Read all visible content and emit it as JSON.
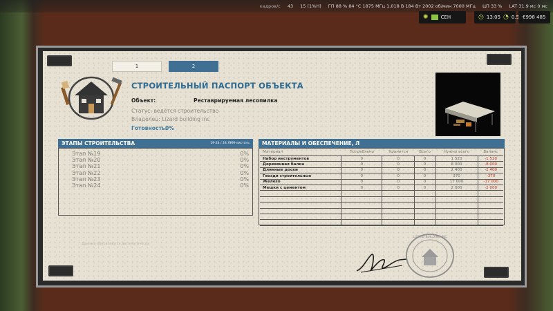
{
  "hud": {
    "fps_label": "кадров/с",
    "fps_value": "43",
    "frame_time": "15 (1%Н)",
    "gpu": "ГП 88 % 84 °C 1875 МГц 1,018 В 184 Вт 2002 об/мин 7000 МГц",
    "cpu": "ЦП 33 %",
    "lat": "LAT 31.9 мс 0 мс",
    "season": "СЕН",
    "time": "13:05",
    "speed": "0.5",
    "money": "€998 485"
  },
  "tabs": [
    {
      "label": "1"
    },
    {
      "label": "2"
    }
  ],
  "passport": {
    "title": "СТРОИТЕЛЬНЫЙ ПАСПОРТ ОБЪЕКТА",
    "object_label": "Объект:",
    "object_value": "Реставрируемая лесопилка",
    "status": "Статус: ведётся строительство",
    "owner": "Владелец: Lizard building inc",
    "ready_label": "Готовность:",
    "ready_value": "0%"
  },
  "stages": {
    "title": "ЭТАПЫ СТРОИТЕЛЬСТВА",
    "paging": "19-24 / 24  ЛКМ-листать",
    "items": [
      {
        "name": "Этап №19",
        "pct": "0%"
      },
      {
        "name": "Этап №20",
        "pct": "0%"
      },
      {
        "name": "Этап №21",
        "pct": "0%"
      },
      {
        "name": "Этап №22",
        "pct": "0%"
      },
      {
        "name": "Этап №23",
        "pct": "0%"
      },
      {
        "name": "Этап №24",
        "pct": "0%"
      }
    ]
  },
  "materials": {
    "title": "МАТЕРИАЛЫ И ОБЕСПЕЧЕНИЕ, Л",
    "columns": [
      "Материал",
      "Потреблено",
      "Хранится",
      "Всего",
      "Нужно всего",
      "Баланс"
    ],
    "rows": [
      [
        "Набор инструментов",
        "0",
        "0",
        "0",
        "1 520",
        "-1 520"
      ],
      [
        "Деревянная балка",
        "0",
        "0",
        "0",
        "8 000",
        "-8 000"
      ],
      [
        "Длинные доски",
        "0",
        "0",
        "0",
        "2 400",
        "-2 400"
      ],
      [
        "Гвозди строительные",
        "0",
        "0",
        "0",
        "370",
        "-370"
      ],
      [
        "Железо",
        "0",
        "0",
        "0",
        "17 000",
        "-17 000"
      ],
      [
        "Мешки с цементом",
        "0",
        "0",
        "0",
        "2 000",
        "-2 000"
      ]
    ],
    "empty_rows": 6
  },
  "footer_note": "Данные обновляются автоматически",
  "stamp_text": "LIZARD BUILDING INC",
  "colors": {
    "accent": "#3f6f92",
    "negative": "#c0392b"
  }
}
